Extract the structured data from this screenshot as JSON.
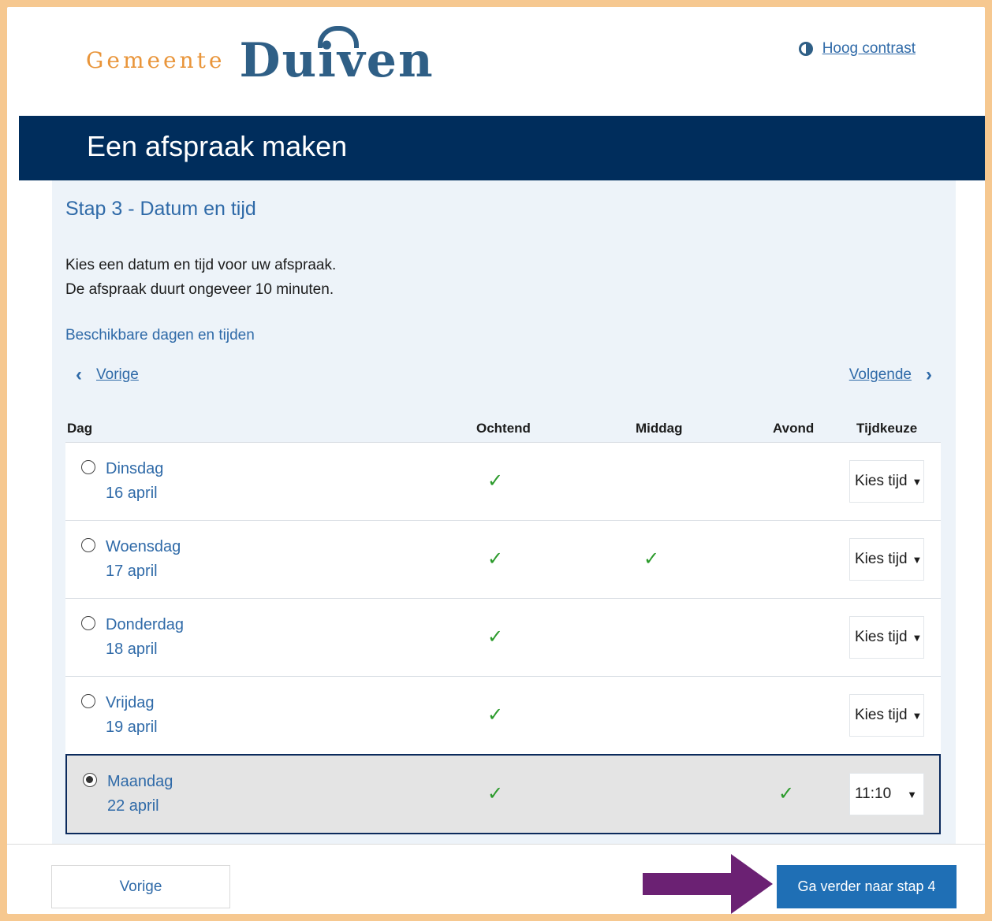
{
  "header": {
    "logo_small": "Gemeente",
    "logo_big": "Duiven",
    "contrast_label": "Hoog contrast"
  },
  "titlebar": {
    "title": "Een afspraak maken"
  },
  "content": {
    "step_title": "Stap 3 - Datum en tijd",
    "intro_line1": "Kies een datum en tijd voor uw afspraak.",
    "intro_line2": "De afspraak duurt ongeveer 10 minuten.",
    "available_label": "Beschikbare dagen en tijden",
    "nav_prev": "Vorige",
    "nav_next": "Volgende"
  },
  "table": {
    "headers": {
      "day": "Dag",
      "morning": "Ochtend",
      "afternoon": "Middag",
      "evening": "Avond",
      "time": "Tijdkeuze"
    },
    "rows": [
      {
        "day": "Dinsdag",
        "date": "16 april",
        "morning": true,
        "afternoon": false,
        "evening": false,
        "time": "Kies tijd",
        "selected": false
      },
      {
        "day": "Woensdag",
        "date": "17 april",
        "morning": true,
        "afternoon": true,
        "evening": false,
        "time": "Kies tijd",
        "selected": false
      },
      {
        "day": "Donderdag",
        "date": "18 april",
        "morning": true,
        "afternoon": false,
        "evening": false,
        "time": "Kies tijd",
        "selected": false
      },
      {
        "day": "Vrijdag",
        "date": "19 april",
        "morning": true,
        "afternoon": false,
        "evening": false,
        "time": "Kies tijd",
        "selected": false
      },
      {
        "day": "Maandag",
        "date": "22 april",
        "morning": true,
        "afternoon": false,
        "evening": true,
        "time": "11:10",
        "selected": true
      }
    ]
  },
  "footer": {
    "back_label": "Vorige",
    "next_label": "Ga verder naar stap 4"
  },
  "icons": {
    "check": "check-icon",
    "chevron_left": "chevron-left-icon",
    "chevron_right": "chevron-right-icon",
    "contrast": "contrast-icon",
    "annotation_arrow": "arrow-right-icon"
  },
  "colors": {
    "navy": "#002d5c",
    "link": "#2f6aa8",
    "check": "#2a9a2a",
    "button": "#1f6fb5",
    "arrow": "#6b2173",
    "frame": "#f6c890"
  }
}
